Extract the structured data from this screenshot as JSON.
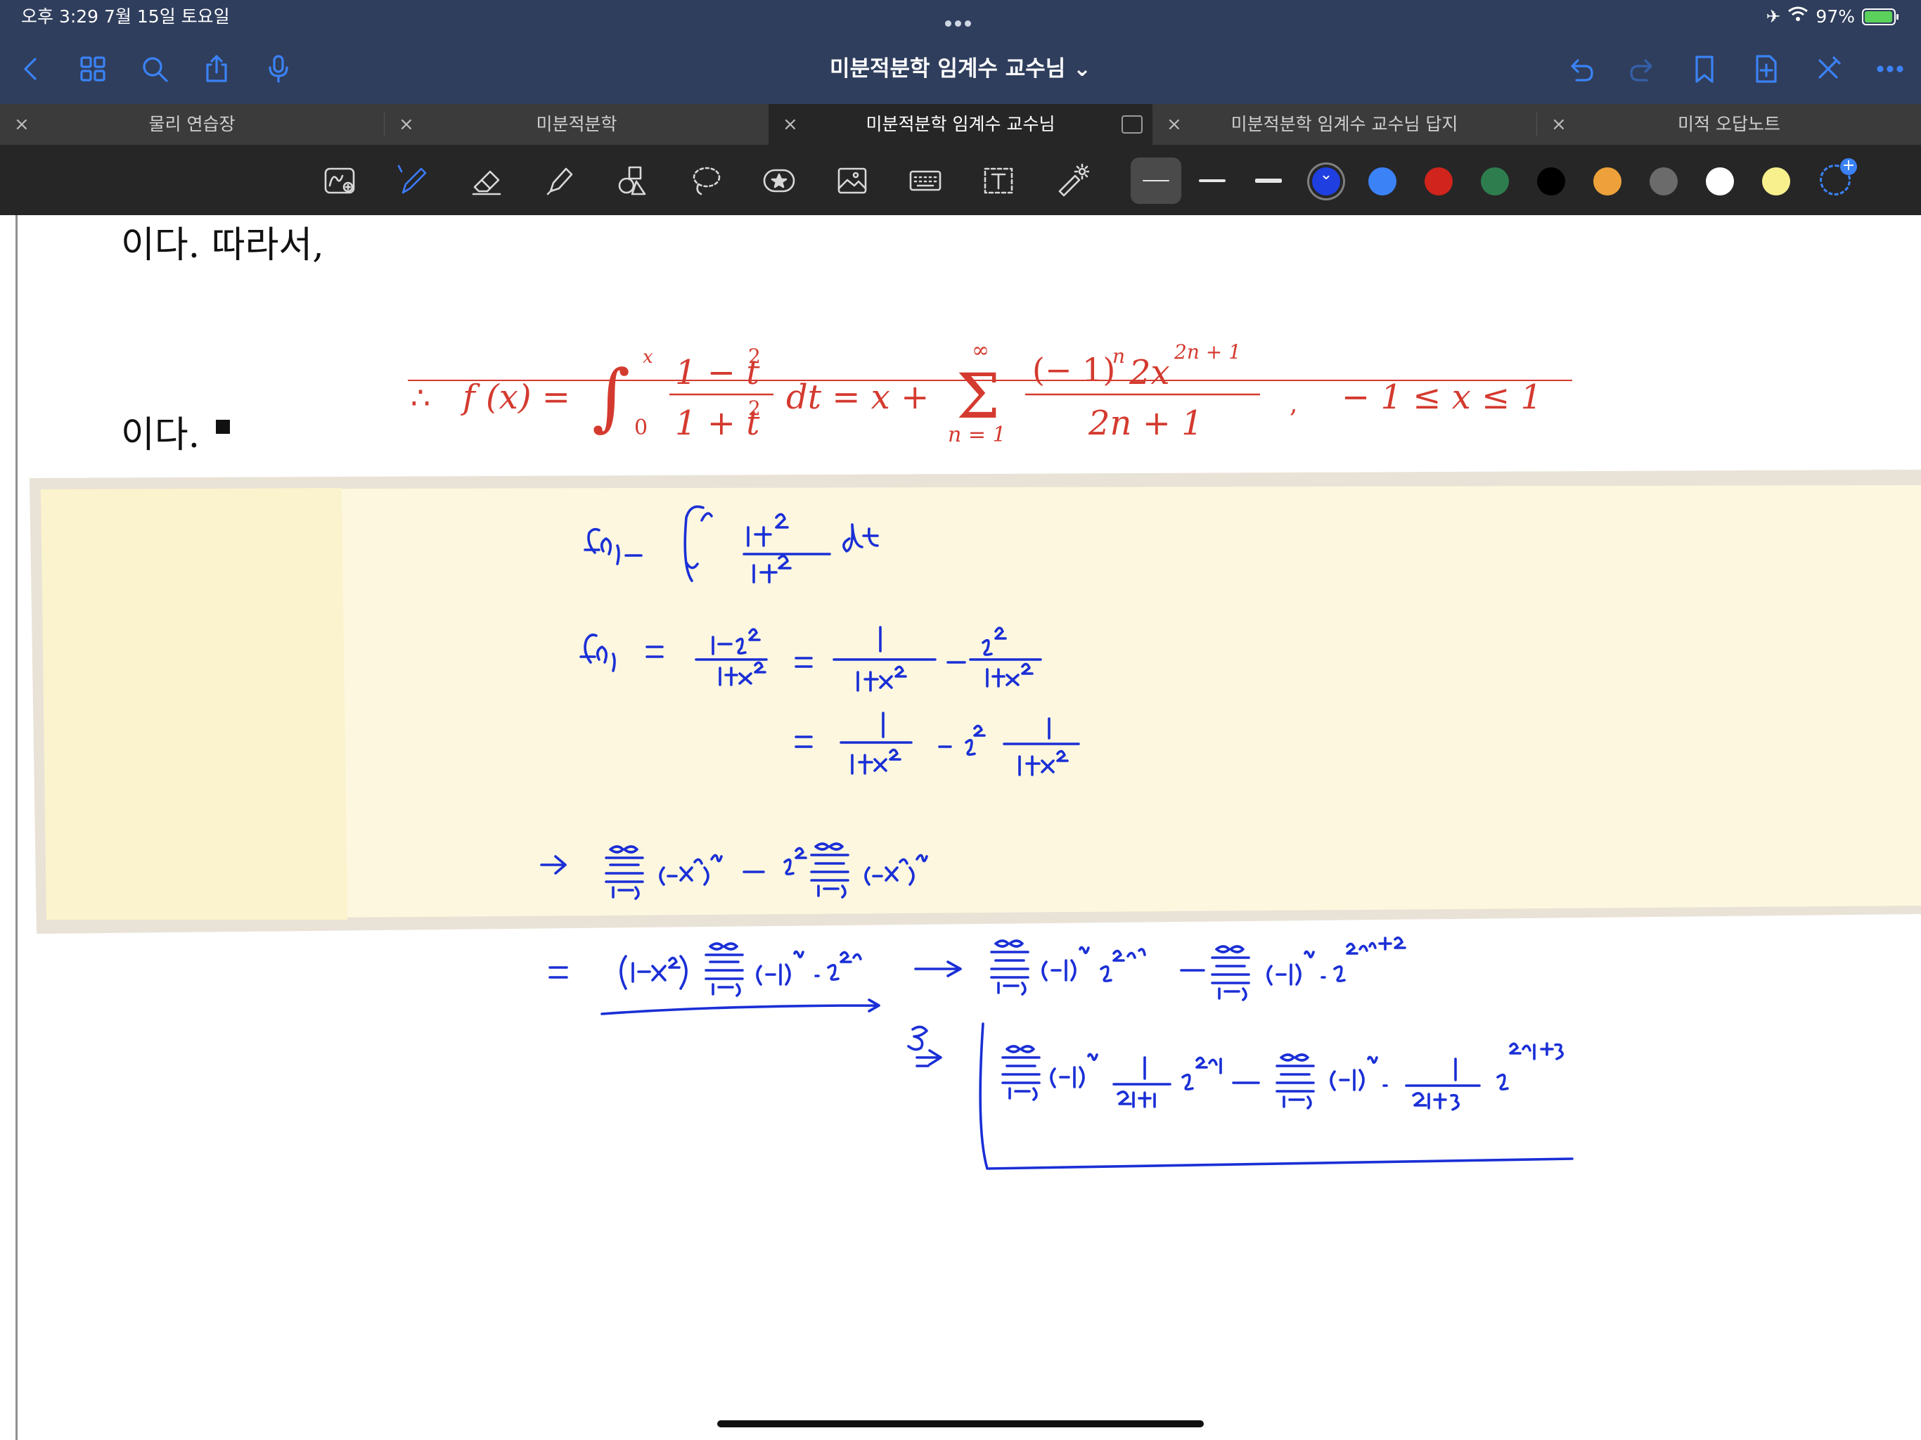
{
  "status": {
    "time_date": "오후 3:29   7월 15일 토요일",
    "battery": "97%",
    "battery_level": 0.97
  },
  "nav": {
    "title": "미분적분학 임계수 교수님 ⌄"
  },
  "tabs": [
    {
      "label": "물리 연습장"
    },
    {
      "label": "미분적분학"
    },
    {
      "label": "미분적분학 임계수 교수님"
    },
    {
      "label": "미분적분학 임계수 교수님 답지"
    },
    {
      "label": "미적 오답노트"
    }
  ],
  "colors": {
    "accent": "#3b82f6",
    "formula": "#d43a2f",
    "ink": "#1a2fd6",
    "note_bg": "#fdf7df"
  },
  "toolbar": {
    "icons": [
      "scribble-icon",
      "pen-icon",
      "eraser-icon",
      "highlighter-icon",
      "shapes-icon",
      "lasso-icon",
      "sticker-icon",
      "image-icon",
      "keyboard-icon",
      "text-box-icon",
      "laser-pointer-icon"
    ],
    "swatches": [
      "#1f3fe0",
      "#3b82f6",
      "#d0241c",
      "#2e7d4f",
      "#000000",
      "#eea13a",
      "#6b6b6b",
      "#ffffff",
      "#f8f08c"
    ]
  },
  "document": {
    "line1": "이다.  따라서,",
    "line2": "이다.",
    "formula": {
      "therefore": "∴",
      "lhs": "f (x) =",
      "int_upper": "x",
      "int_lower": "0",
      "frac1_num": "1 − t",
      "frac1_den": "1 + t",
      "sq": "2",
      "dt": "dt = x +",
      "sum_top": "∞",
      "sum_sign": "Σ",
      "sum_bottom": "n = 1",
      "frac2_num": "(− 1)",
      "frac2_num_exp_n": "n",
      "frac2_num_b": "2x",
      "frac2_num_exp": "2n + 1",
      "frac2_den": "2n + 1",
      "comma": ",",
      "domain": "− 1 ≤ x ≤ 1"
    }
  }
}
